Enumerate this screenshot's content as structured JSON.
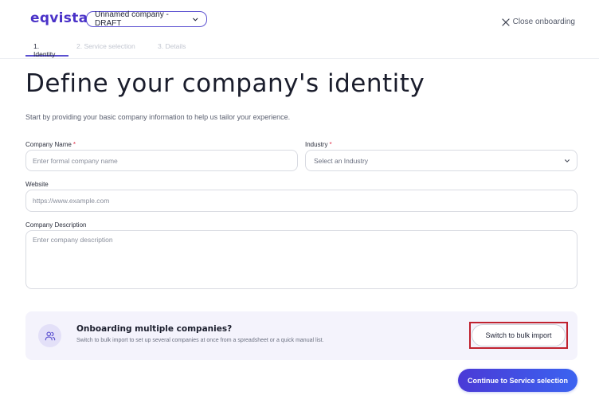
{
  "header": {
    "logo_text": "eqvista",
    "company_select": "Unnamed company - DRAFT",
    "close_label": "Close onboarding"
  },
  "steps": [
    {
      "label": "1. Identity",
      "state": "active"
    },
    {
      "label": "2. Service selection",
      "state": "upcoming"
    },
    {
      "label": "3. Details",
      "state": "upcoming"
    }
  ],
  "page": {
    "title": "Define your company's identity",
    "subtitle": "Start by providing your basic company information to help us tailor your experience."
  },
  "form": {
    "company_name": {
      "label": "Company Name",
      "required_mark": "*",
      "placeholder": "Enter formal company name",
      "value": ""
    },
    "industry": {
      "label": "Industry",
      "required_mark": "*",
      "placeholder": "Select an Industry"
    },
    "website": {
      "label": "Website",
      "placeholder": "https://www.example.com",
      "value": ""
    },
    "description": {
      "label": "Company Description",
      "placeholder": "Enter company description",
      "value": ""
    }
  },
  "bulk": {
    "title": "Onboarding multiple companies?",
    "description": "Switch to bulk import to set up several companies at once from a spreadsheet or a quick manual list.",
    "button_label": "Switch to bulk import",
    "icon": "users-icon"
  },
  "footer": {
    "continue_label": "Continue to Service selection"
  },
  "colors": {
    "brand": "#4a32c8",
    "accent": "#5b50d0",
    "required": "#e0314a",
    "highlight_outline": "#c0222f"
  }
}
